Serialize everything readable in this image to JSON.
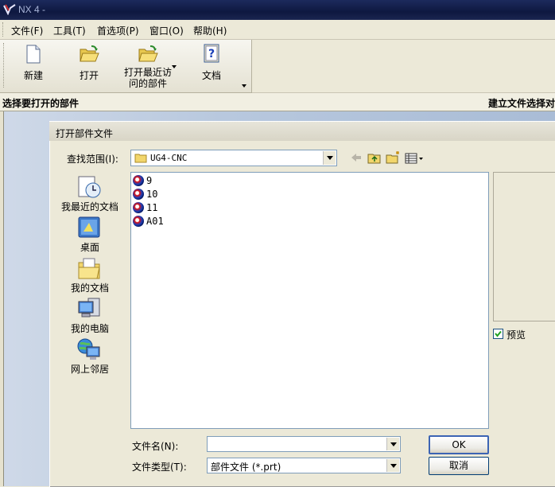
{
  "app": {
    "title": "NX 4 -"
  },
  "menu": [
    {
      "label": "文件(F)"
    },
    {
      "label": "工具(T)"
    },
    {
      "label": "首选项(P)"
    },
    {
      "label": "窗口(O)"
    },
    {
      "label": "帮助(H)"
    }
  ],
  "toolbar": {
    "new_label": "新建",
    "open_label": "打开",
    "recent_label_1": "打开最近访",
    "recent_label_2": "问的部件",
    "docs_label": "文档"
  },
  "prompt": {
    "left": "选择要打开的部件",
    "right": "建立文件选择对"
  },
  "dialog": {
    "title": "打开部件文件",
    "lookin_label": "查找范围(I):",
    "lookin_value": "UG4-CNC",
    "places": [
      {
        "label": "我最近的文档"
      },
      {
        "label": "桌面"
      },
      {
        "label": "我的文档"
      },
      {
        "label": "我的电脑"
      },
      {
        "label": "网上邻居"
      }
    ],
    "files": [
      {
        "name": "9"
      },
      {
        "name": "10"
      },
      {
        "name": "11"
      },
      {
        "name": "A01"
      }
    ],
    "preview_label": "预览",
    "preview_checked": true,
    "filename_label": "文件名(N):",
    "filename_value": "",
    "filetype_label": "文件类型(T):",
    "filetype_value": "部件文件 (*.prt)",
    "ok_label": "OK",
    "cancel_label": "取消"
  }
}
